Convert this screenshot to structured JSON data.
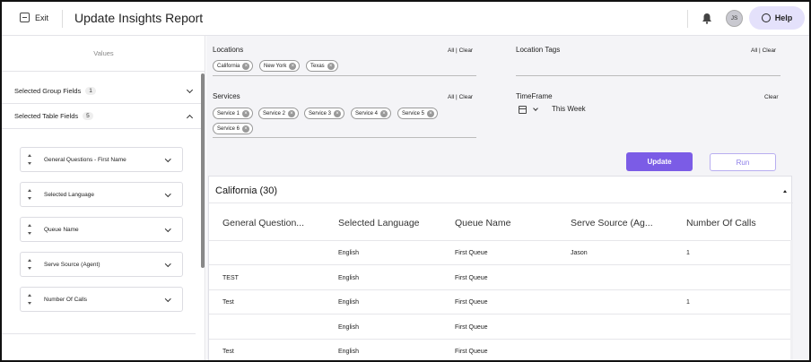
{
  "header": {
    "exit_label": "Exit",
    "title": "Update Insights Report",
    "avatar_initials": "JS",
    "help_label": "Help"
  },
  "sidebar": {
    "values_label": "Values",
    "sections": [
      {
        "label": "Selected Group Fields",
        "count": "1"
      },
      {
        "label": "Selected Table Fields",
        "count": "5"
      }
    ],
    "fields": [
      "General Questions - First Name",
      "Selected Language",
      "Queue Name",
      "Serve Source (Agent)",
      "Number Of Calls"
    ]
  },
  "filters": {
    "locations": {
      "label": "Locations",
      "all": "All",
      "clear": "Clear",
      "chips": [
        "California",
        "New York",
        "Texas"
      ]
    },
    "location_tags": {
      "label": "Location Tags",
      "all": "All",
      "clear": "Clear"
    },
    "services": {
      "label": "Services",
      "all": "All",
      "clear": "Clear",
      "chips": [
        "Service 1",
        "Service 2",
        "Service 3",
        "Service 4",
        "Service 5",
        "Service 6"
      ]
    },
    "timeframe": {
      "label": "TimeFrame",
      "clear": "Clear",
      "value": "This Week"
    },
    "separator": "|"
  },
  "actions": {
    "update_label": "Update",
    "run_label": "Run"
  },
  "table": {
    "group_title": "California (30)",
    "columns": [
      "General Question...",
      "Selected Language",
      "Queue Name",
      "Serve Source (Ag...",
      "Number Of Calls"
    ],
    "rows": [
      [
        "",
        "English",
        "First Queue",
        "Jason",
        "1"
      ],
      [
        "TEST",
        "English",
        "First Queue",
        "",
        ""
      ],
      [
        "Test",
        "English",
        "First Queue",
        "",
        "1"
      ],
      [
        "",
        "English",
        "First Queue",
        "",
        ""
      ],
      [
        "Test",
        "English",
        "First Queue",
        "",
        ""
      ]
    ]
  },
  "colors": {
    "accent": "#7b5ce6",
    "help_bg": "#e4e1fb",
    "panel_bg": "#f4f4f7"
  }
}
